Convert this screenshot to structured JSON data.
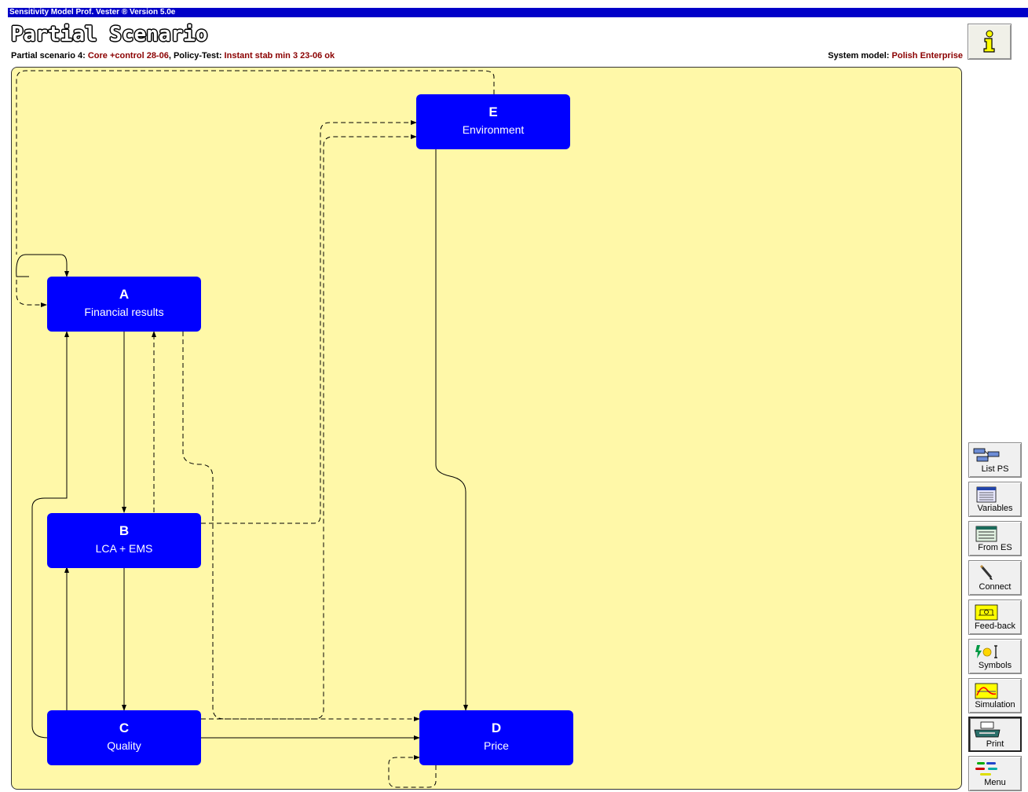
{
  "window": {
    "title": "Sensitivity Model Prof. Vester ® Version 5.0e"
  },
  "header": {
    "title": "Partial Scenario",
    "scenario_prefix": "Partial scenario 4: ",
    "scenario_name": "Core +control 28-06",
    "policy_prefix": ", Policy-Test: ",
    "policy_name": "Instant stab min 3 23-06 ok",
    "system_model_prefix": "System model: ",
    "system_model_name": "Polish Enterprise",
    "info_icon": "info-icon"
  },
  "nodes": [
    {
      "id": "A",
      "letter": "A",
      "label": "Financial results"
    },
    {
      "id": "B",
      "letter": "B",
      "label": "LCA + EMS"
    },
    {
      "id": "C",
      "letter": "C",
      "label": "Quality"
    },
    {
      "id": "D",
      "letter": "D",
      "label": "Price"
    },
    {
      "id": "E",
      "letter": "E",
      "label": "Environment"
    }
  ],
  "connections": [
    {
      "from": "A",
      "to": "A",
      "kind": "solid"
    },
    {
      "from": "A",
      "to": "A",
      "kind": "dashed"
    },
    {
      "from": "A",
      "to": "B",
      "kind": "solid"
    },
    {
      "from": "B",
      "to": "A",
      "kind": "dashed"
    },
    {
      "from": "B",
      "to": "C",
      "kind": "solid"
    },
    {
      "from": "C",
      "to": "B",
      "kind": "solid"
    },
    {
      "from": "C",
      "to": "A",
      "kind": "solid"
    },
    {
      "from": "C",
      "to": "D",
      "kind": "solid"
    },
    {
      "from": "C",
      "to": "E",
      "kind": "dashed"
    },
    {
      "from": "B",
      "to": "E",
      "kind": "dashed"
    },
    {
      "from": "A",
      "to": "D",
      "kind": "dashed"
    },
    {
      "from": "E",
      "to": "D",
      "kind": "solid"
    },
    {
      "from": "E",
      "to": "A",
      "kind": "dashed"
    },
    {
      "from": "D",
      "to": "D",
      "kind": "dashed"
    }
  ],
  "toolbar": [
    {
      "label": "List PS",
      "icon": "list-ps-icon"
    },
    {
      "label": "Variables",
      "icon": "variables-icon"
    },
    {
      "label": "From ES",
      "icon": "from-es-icon"
    },
    {
      "label": "Connect",
      "icon": "pencil-icon"
    },
    {
      "label": "Feed-back",
      "icon": "feedback-icon"
    },
    {
      "label": "Symbols",
      "icon": "symbols-icon"
    },
    {
      "label": "Simulation",
      "icon": "simulation-icon"
    },
    {
      "label": "Print",
      "icon": "printer-icon"
    },
    {
      "label": "Menu",
      "icon": "menu-icon"
    }
  ],
  "colors": {
    "node": "#0000ff",
    "canvas": "#fff8a8",
    "highlight": "#8b0000",
    "titlebar": "#0000c8"
  }
}
